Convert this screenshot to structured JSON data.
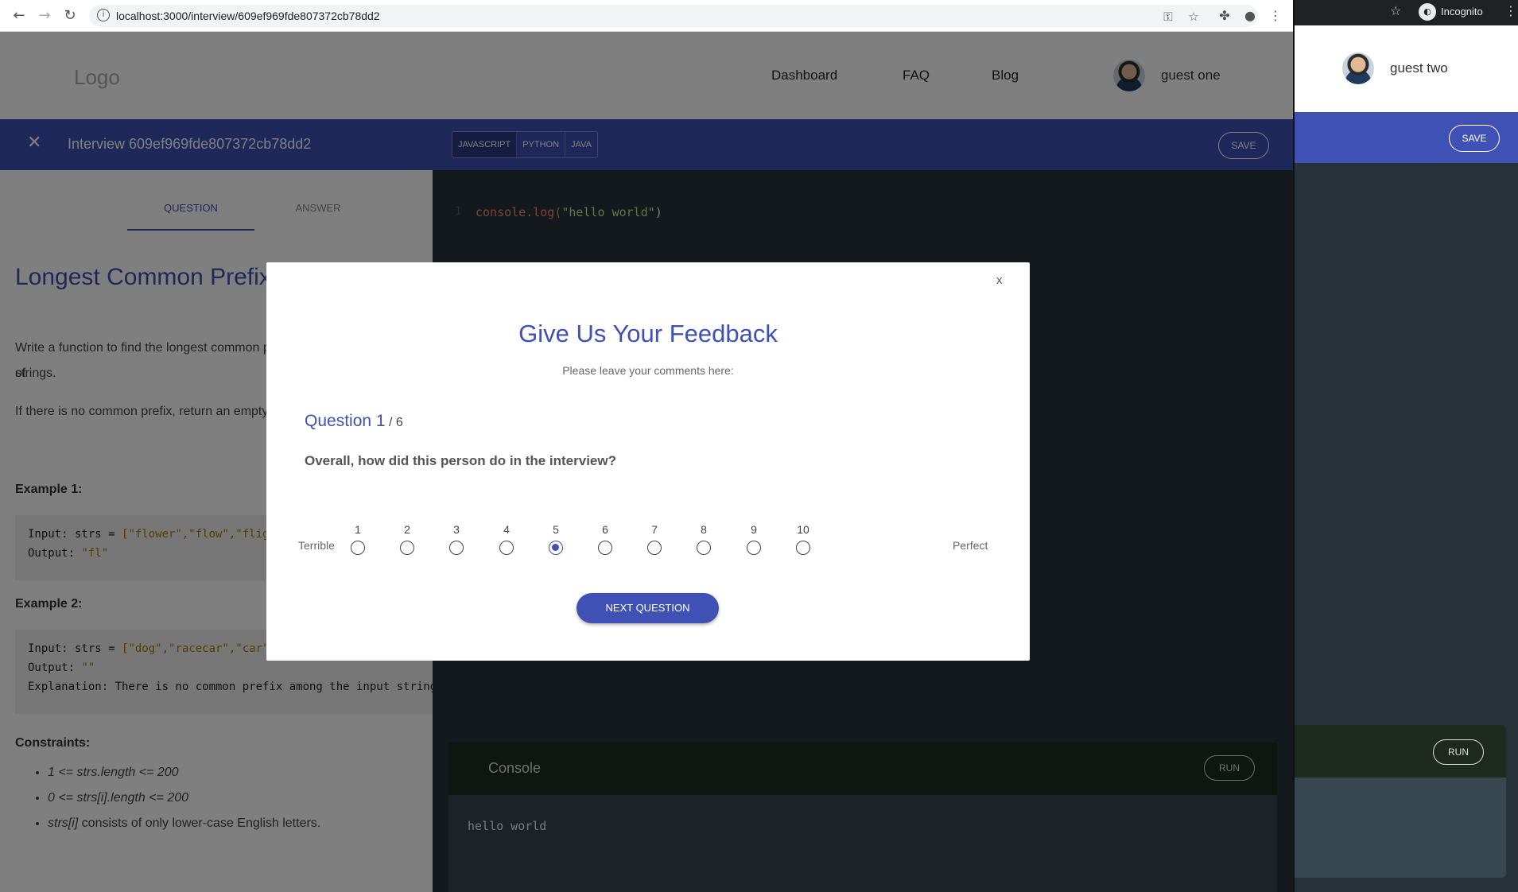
{
  "browser": {
    "url": "localhost:3000/interview/609ef969fde807372cb78dd2"
  },
  "nav": {
    "logo": "Logo",
    "links": [
      "Dashboard",
      "FAQ",
      "Blog"
    ],
    "user": "guest one"
  },
  "toolbar": {
    "interview_title": "Interview 609ef969fde807372cb78dd2",
    "languages": [
      "JAVASCRIPT",
      "PYTHON",
      "JAVA"
    ],
    "active_language": "JAVASCRIPT",
    "save_label": "SAVE"
  },
  "problem": {
    "tabs": [
      "QUESTION",
      "ANSWER"
    ],
    "title": "Longest Common Prefix",
    "description_1": "Write a function to find the longest common prefix string amongst an array of",
    "description_1b": "strings.",
    "description_2": "If there is no common prefix, return an empty string \"\".",
    "example1_heading": "Example 1:",
    "example1_input_label": "Input: strs = ",
    "example1_input_value": "[\"flower\",\"flow\",\"flight\"]",
    "example1_output_label": "Output: ",
    "example1_output_value": "\"fl\"",
    "example2_heading": "Example 2:",
    "example2_input_label": "Input: strs = ",
    "example2_input_value": "[\"dog\",\"racecar\",\"car\"]",
    "example2_output_label": "Output: ",
    "example2_output_value": "\"\"",
    "example2_explanation": "Explanation: There is no common prefix among the input strings.",
    "constraints_heading": "Constraints:",
    "constraints": [
      {
        "em": "1 <= strs.length <= 200",
        "rest": ""
      },
      {
        "em": "0 <= strs[i].length <= 200",
        "rest": ""
      },
      {
        "em": "strs[i]",
        "rest": " consists of only lower-case English letters."
      }
    ]
  },
  "editor": {
    "line_number": "1",
    "code_fn": "console.log(",
    "code_str": "\"hello world\"",
    "code_end": ")"
  },
  "console": {
    "title": "Console",
    "run_label": "RUN",
    "output": "hello world"
  },
  "modal": {
    "close_label": "x",
    "title": "Give Us Your Feedback",
    "subtitle": "Please leave your comments here:",
    "question_label": "Question 1",
    "question_total": " / 6",
    "prompt": "Overall, how did this person do in the interview?",
    "scale_low": "Terrible",
    "scale_high": "Perfect",
    "scale": [
      "1",
      "2",
      "3",
      "4",
      "5",
      "6",
      "7",
      "8",
      "9",
      "10"
    ],
    "selected": "5",
    "next_label": "NEXT QUESTION"
  },
  "second_window": {
    "incognito_label": "Incognito",
    "user": "guest two",
    "save_label": "SAVE",
    "run_label": "RUN"
  }
}
